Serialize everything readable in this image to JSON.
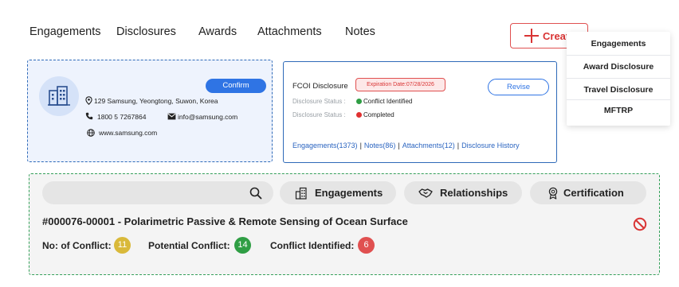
{
  "tabs": [
    "Engagements",
    "Disclosures",
    "Awards",
    "Attachments",
    "Notes"
  ],
  "create": {
    "label": "Create"
  },
  "dropdown": {
    "items": [
      "Engagements",
      "Award Disclosure",
      "Travel Disclosure",
      "MFTRP"
    ]
  },
  "company": {
    "confirm_label": "Confirm",
    "address": "129 Samsung, Yeongtong, Suwon, Korea",
    "phone": "1800 5 7267864",
    "email": "info@samsung.com",
    "website": "www.samsung.com"
  },
  "disclosure": {
    "title": "FCOI Disclosure",
    "expiration": "Expiration Date:07/28/2026",
    "revise_label": "Revise",
    "status_rows": [
      {
        "label": "Disclosure Status :",
        "value": "Conflict Identified",
        "color": "#2f9e44"
      },
      {
        "label": "Disclosure Status :",
        "value": "Completed",
        "color": "#e03131"
      }
    ],
    "links": [
      "Engagements(1373)",
      "Notes(86)",
      "Attachments(12)",
      "Disclosure History"
    ]
  },
  "panel": {
    "search_placeholder": "",
    "pills": [
      "Engagements",
      "Relationships",
      "Certification"
    ],
    "project_title": "#000076-00001 - Polarimetric Passive & Remote Sensing of Ocean Surface",
    "counts": [
      {
        "label": "No: of Conflict:",
        "value": "11",
        "color": "#d9b93a"
      },
      {
        "label": "Potential Conflict:",
        "value": "14",
        "color": "#2f9e44"
      },
      {
        "label": "Conflict Identified:",
        "value": "6",
        "color": "#e05050"
      }
    ]
  },
  "colors": {
    "primary": "#2f74e4",
    "danger": "#d93434",
    "success": "#2f9e44",
    "warning": "#d9b93a"
  }
}
